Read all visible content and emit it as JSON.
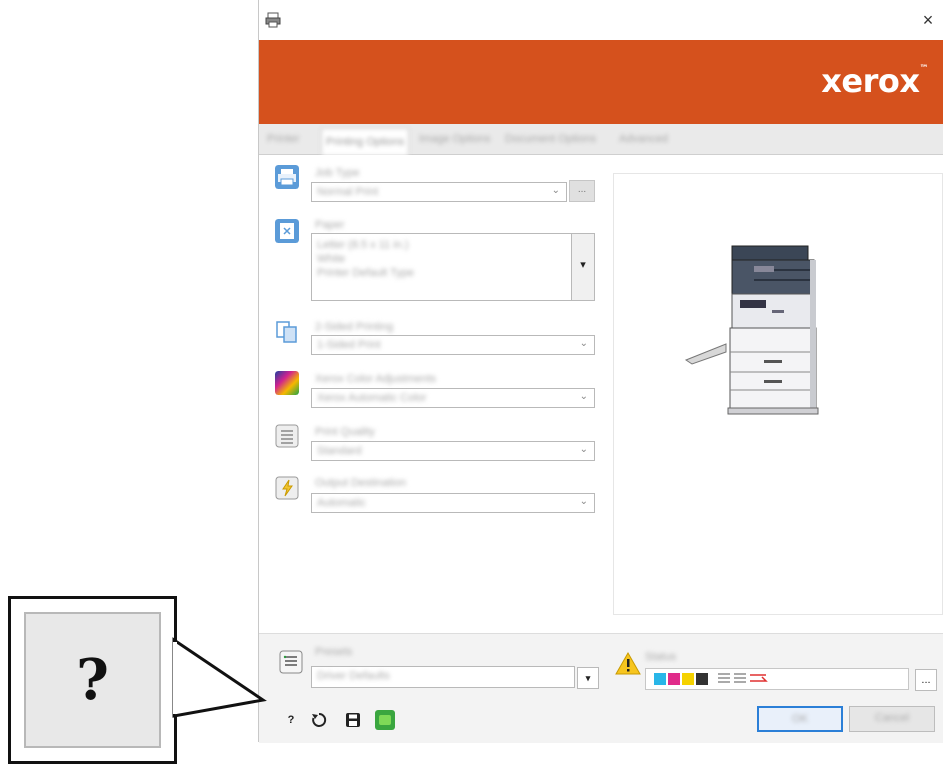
{
  "window": {
    "title": "",
    "close_label": "×"
  },
  "banner": {
    "logo_text": "xerox",
    "logo_tm": "™",
    "brand_color": "#d5511d"
  },
  "tabs": [
    {
      "label": "Printer"
    },
    {
      "label": "Printing Options",
      "active": true
    },
    {
      "label": "Image Options"
    },
    {
      "label": "Document Options"
    },
    {
      "label": "Advanced"
    }
  ],
  "settings": {
    "job_type": {
      "label": "Job Type",
      "value": "Normal Print",
      "icon": "printer-icon"
    },
    "paper": {
      "label": "Paper",
      "lines": [
        "Letter (8.5 x 11 in.)",
        "White",
        "Printer Default Type"
      ],
      "icon": "paper-icon"
    },
    "two_sided": {
      "label": "2-Sided Printing",
      "value": "1-Sided Print",
      "icon": "duplex-icon"
    },
    "color": {
      "label": "Xerox Color Adjustments",
      "value": "Xerox Automatic Color",
      "icon": "color-icon"
    },
    "print_quality": {
      "label": "Print Quality",
      "value": "Standard",
      "icon": "quality-icon"
    },
    "output_dest": {
      "label": "Output Destination",
      "value": "Automatic",
      "icon": "output-icon"
    }
  },
  "bottom": {
    "presets_label": "Presets",
    "presets_value": "Driver Defaults",
    "status_label": "Status",
    "ok_label": "OK",
    "cancel_label": "Cancel",
    "more_label": "...",
    "list_button_label": "▾"
  },
  "callout": {
    "symbol": "?"
  }
}
